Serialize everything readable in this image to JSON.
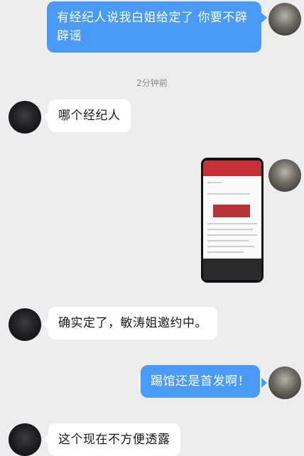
{
  "messages": {
    "m1": "有经纪人说我白姐给定了 你要不辟辟谣",
    "m2": "哪个经纪人",
    "m3": "确实定了，敏涛姐邀约中。",
    "m4": "踢馆还是首发啊！",
    "m5": "这个现在不方便透露"
  },
  "timestamp": "2分钟前",
  "colors": {
    "background": "#ededed",
    "outgoing_bubble": "#4a9bf5",
    "incoming_bubble": "#ffffff"
  }
}
